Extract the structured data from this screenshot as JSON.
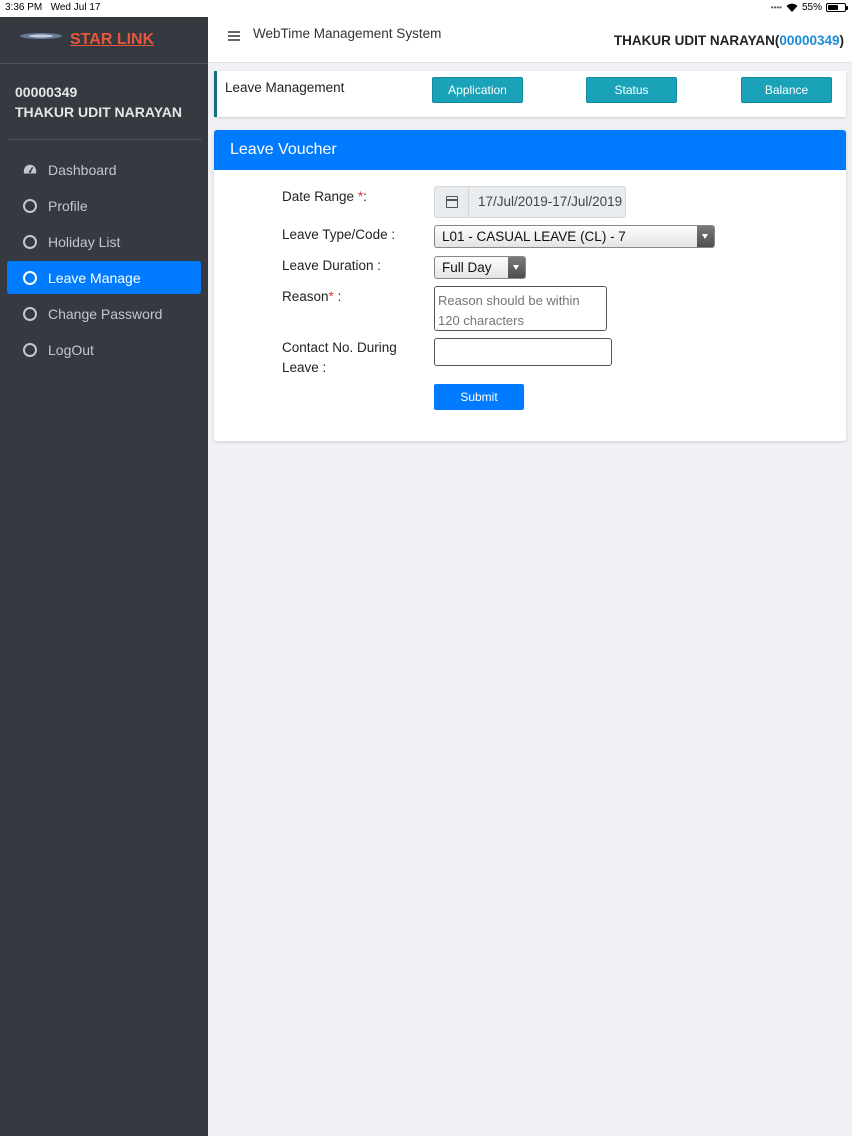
{
  "status_bar": {
    "time": "3:36 PM",
    "date": "Wed Jul 17",
    "battery": "55%",
    "battery_level": 0.55
  },
  "sidebar": {
    "brand": "STAR LINK",
    "user_id": "00000349",
    "user_name": "THAKUR UDIT NARAYAN",
    "items": [
      {
        "label": "Dashboard",
        "icon": "dashboard-icon",
        "active": false
      },
      {
        "label": "Profile",
        "icon": "circle-icon",
        "active": false
      },
      {
        "label": "Holiday List",
        "icon": "circle-icon",
        "active": false
      },
      {
        "label": "Leave Manage",
        "icon": "circle-icon",
        "active": true
      },
      {
        "label": "Change Password",
        "icon": "circle-icon",
        "active": false
      },
      {
        "label": "LogOut",
        "icon": "circle-icon",
        "active": false
      }
    ]
  },
  "header": {
    "title": "WebTime Management System",
    "user_name": "THAKUR UDIT NARAYAN",
    "user_code": "00000349",
    "paren_open": "(",
    "paren_close": ")"
  },
  "leave_management": {
    "title": "Leave Management",
    "buttons": [
      "Application",
      "Status",
      "Balance"
    ]
  },
  "form": {
    "title": "Leave Voucher",
    "date_label": "Date Range ",
    "date_suffix": ":",
    "date_value": "17/Jul/2019-17/Jul/2019",
    "leave_type_label": "Leave Type/Code :",
    "leave_type_value": "L01 - CASUAL LEAVE (CL) - 7",
    "duration_label": "Leave Duration :",
    "duration_value": "Full Day",
    "reason_label": "Reason",
    "reason_suffix": " :",
    "reason_placeholder": "Reason should be within 120 characters",
    "contact_label_1": "Contact No. During",
    "contact_label_2": "Leave :",
    "contact_value": "",
    "submit_label": "Submit",
    "required_mark": "*"
  },
  "colors": {
    "accent": "#007bff",
    "sidebar": "#343a40",
    "teal_button": "#1aa3b8",
    "brand": "#e8573a",
    "required": "#dc3545"
  }
}
